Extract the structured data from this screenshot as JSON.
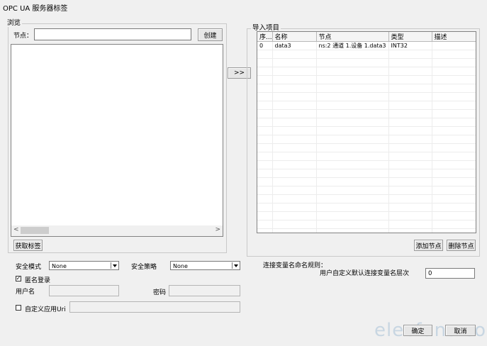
{
  "window": {
    "title": "OPC UA 服务器标签"
  },
  "browse": {
    "legend": "浏览",
    "node_label": "节点：",
    "node_value": "",
    "create_button": "创建",
    "scroll_left": "<",
    "scroll_right": ">",
    "get_tags_button": "获取标签"
  },
  "transfer_button": ">>",
  "import": {
    "legend": "导入项目",
    "columns": [
      "序...",
      "名称",
      "节点",
      "类型",
      "描述"
    ],
    "rows": [
      {
        "index": "0",
        "name": "data3",
        "node": "ns:2 通道 1.设备 1.data3",
        "type": "INT32",
        "desc": ""
      }
    ],
    "add_node_button": "添加节点",
    "delete_node_button": "删除节点"
  },
  "security": {
    "mode_label": "安全模式",
    "mode_value": "None",
    "policy_label": "安全策略",
    "policy_value": "None",
    "anonymous_label": "匿名登录",
    "anonymous_checked": true,
    "username_label": "用户名",
    "username_value": "",
    "password_label": "密码",
    "password_value": "",
    "custom_uri_label": "自定义应用Uri",
    "custom_uri_checked": false,
    "custom_uri_value": ""
  },
  "naming": {
    "rule_label": "连接变量名命名规则：",
    "level_label": "用户自定义默认连接变量名层次",
    "level_value": "0"
  },
  "footer": {
    "ok_button": "确定",
    "cancel_button": "取消",
    "watermark": "elecfans.com"
  }
}
